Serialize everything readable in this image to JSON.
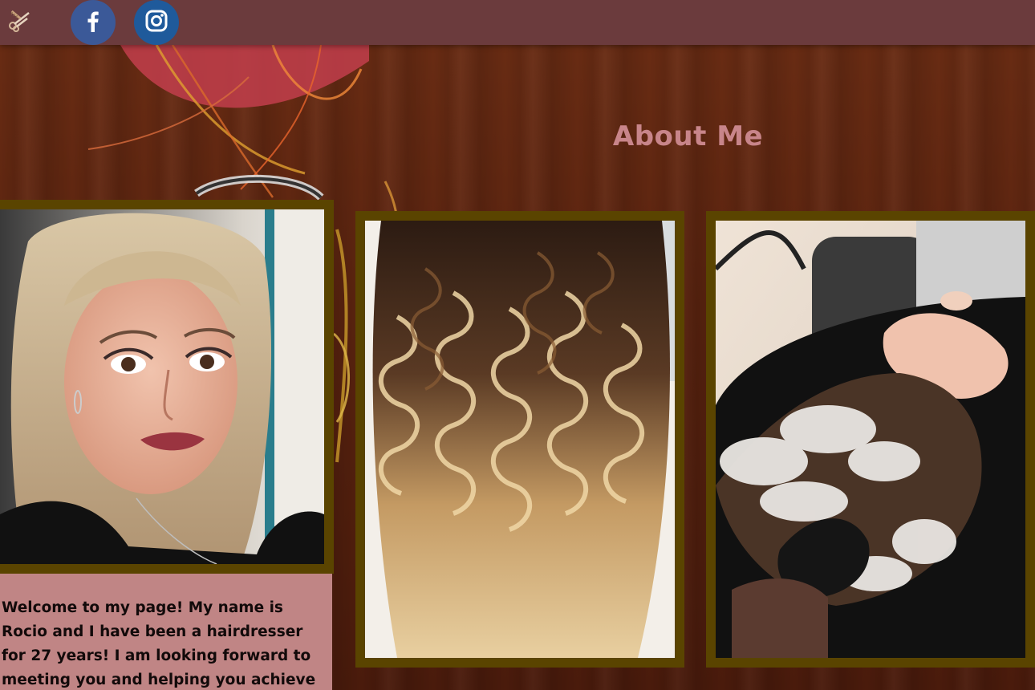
{
  "header": {
    "logo_icon": "scissors-comb-icon",
    "social": [
      {
        "name": "facebook",
        "icon": "facebook-icon",
        "color": "#3b5998",
        "glyph": "f"
      },
      {
        "name": "instagram",
        "icon": "instagram-icon",
        "color": "#1f5a9b"
      }
    ]
  },
  "main": {
    "title": "About Me",
    "bio": "Welcome to my page! My name is Rocio and I have been a hairdresser for 27 years! I am looking forward to meeting you and helping you achieve"
  },
  "gallery": [
    {
      "icon": "portrait-photo",
      "alt": "Portrait of the stylist"
    },
    {
      "icon": "curly-hair-photo",
      "alt": "Curled balayage hair"
    },
    {
      "icon": "hair-wash-photo",
      "alt": "Client getting hair washed"
    }
  ],
  "colors": {
    "topbar": "#6b3b3d",
    "title": "#c8858a",
    "frame": "#5a4400",
    "bio_card": "#c08585",
    "bio_text": "#120a0a"
  }
}
